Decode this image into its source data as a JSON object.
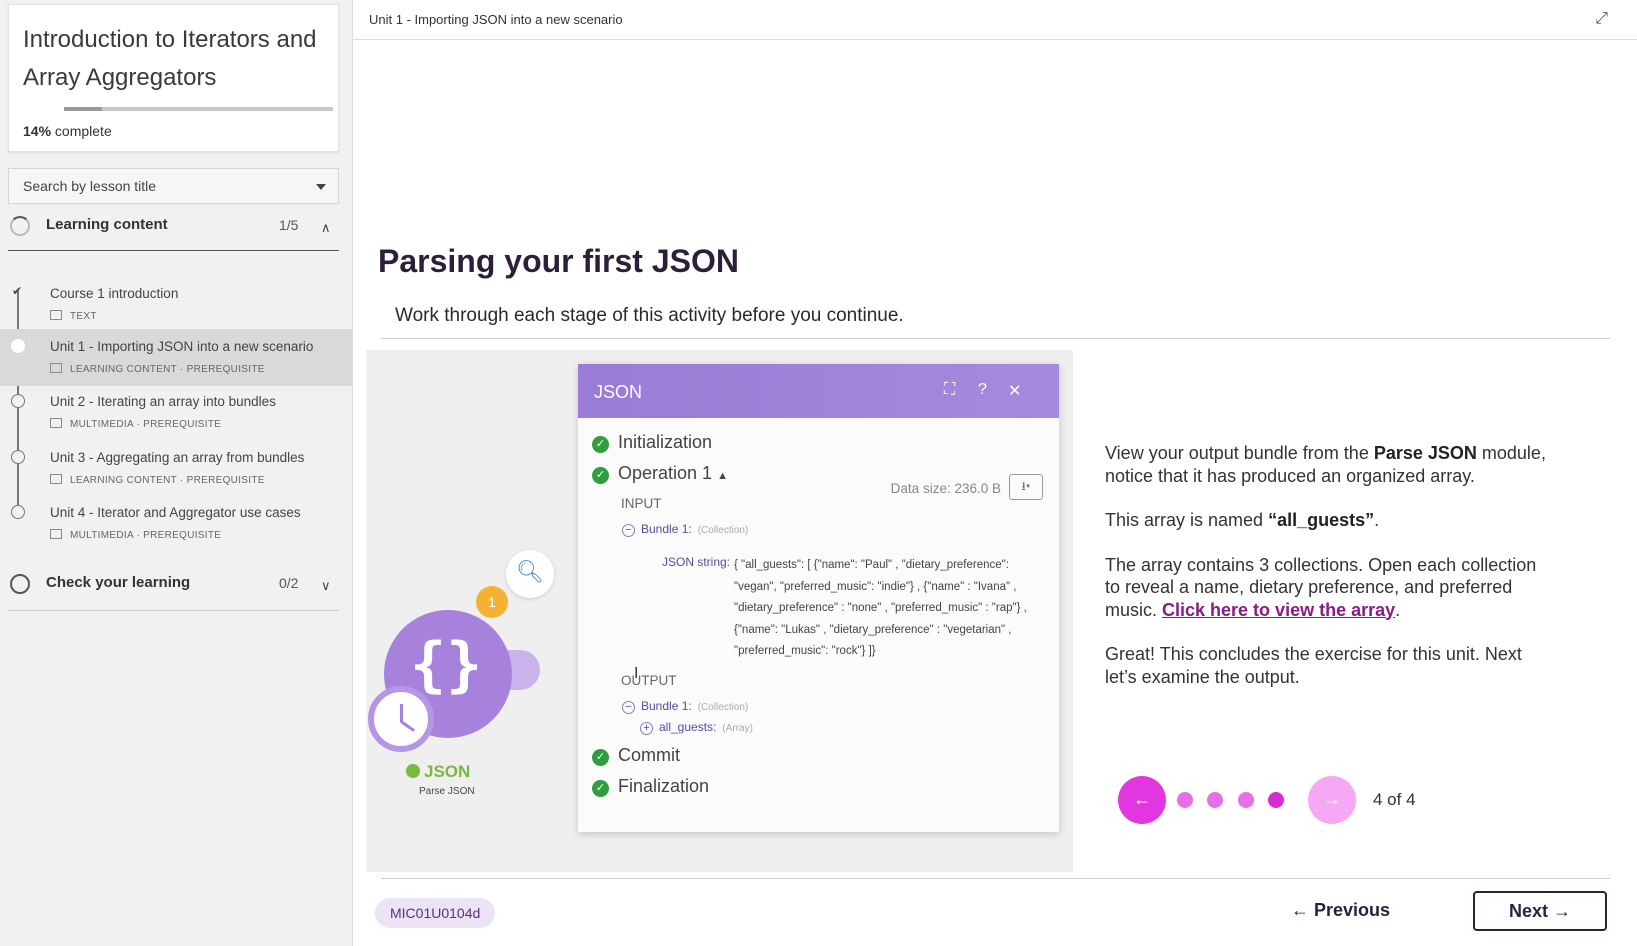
{
  "course": {
    "title": "Introduction to Iterators and Array Aggregators",
    "progress_percent": "14%",
    "progress_suffix": " complete",
    "progress_value": 0.14
  },
  "search": {
    "placeholder": "Search by lesson title"
  },
  "sections": [
    {
      "title": "Learning content",
      "count": "1/5",
      "expanded": true
    },
    {
      "title": "Check your learning",
      "count": "0/2",
      "expanded": false
    }
  ],
  "lessons": [
    {
      "title": "Course 1 introduction",
      "meta": "TEXT",
      "status": "complete"
    },
    {
      "title": "Unit 1 - Importing JSON into a new scenario",
      "meta": "LEARNING CONTENT · PREREQUISITE",
      "status": "active"
    },
    {
      "title": "Unit 2 - Iterating an array into bundles",
      "meta": "MULTIMEDIA · PREREQUISITE",
      "status": "todo"
    },
    {
      "title": "Unit 3 - Aggregating an array from bundles",
      "meta": "LEARNING CONTENT · PREREQUISITE",
      "status": "todo"
    },
    {
      "title": "Unit 4 - Iterator and Aggregator use cases",
      "meta": "MULTIMEDIA · PREREQUISITE",
      "status": "todo"
    }
  ],
  "topbar": {
    "breadcrumb": "Unit 1 - Importing JSON into a new scenario"
  },
  "content": {
    "heading": "Parsing your first JSON",
    "subheading": "Work through each stage of this activity before you continue."
  },
  "json_panel": {
    "title": "JSON",
    "stages": [
      "Initialization",
      "Operation 1",
      "Commit",
      "Finalization"
    ],
    "data_size": "Data size: 236.0 B",
    "input_label": "INPUT",
    "output_label": "OUTPUT",
    "bundle_label": "Bundle 1:",
    "collection_label": "(Collection)",
    "json_string_label": "JSON string:",
    "json_string": "{ \"all_guests\": [ {\"name\": \"Paul\" , \"dietary_preference\": \"vegan\", \"preferred_music\": \"indie\"} , {\"name\" : \"Ivana\" , \"dietary_preference\" : \"none\" , \"preferred_music\" : \"rap\"} , {\"name\": \"Lukas\" , \"dietary_preference\" : \"vegetarian\" , \"preferred_music\": \"rock\"} ]}",
    "all_guests_label": "all_guests:",
    "array_label": "(Array)",
    "module_name": "JSON",
    "module_sub": "Parse JSON",
    "badge": "1"
  },
  "explain": {
    "p1_pre": "View your output bundle from the ",
    "p1_bold": "Parse JSON",
    "p1_post": " module, notice that it has produced an organized array.",
    "p2_pre": "This array is named ",
    "p2_bold": "“all_guests”",
    "p2_post": ".",
    "p3_pre": "The array contains 3 collections. Open each collection to reveal a name, dietary preference, and preferred music. ",
    "p3_link": "Click here to view the array",
    "p3_post": ".",
    "p4": "Great! This concludes the exercise for this unit. Next let’s examine the output."
  },
  "pager": {
    "count": "4 of 4",
    "current": 4,
    "total": 4
  },
  "footer": {
    "code": "MIC01U0104d",
    "previous": "← Previous",
    "next": "Next →"
  },
  "colors": {
    "accent": "#d62dd3",
    "module": "#a682dc",
    "ok": "#2e9e3f"
  },
  "icons": [
    "expand-icon",
    "caret-down-icon",
    "chevron-up-icon",
    "chevron-down-icon",
    "check-icon",
    "search-icon",
    "help-icon",
    "close-icon",
    "download-icon",
    "clock-icon"
  ]
}
